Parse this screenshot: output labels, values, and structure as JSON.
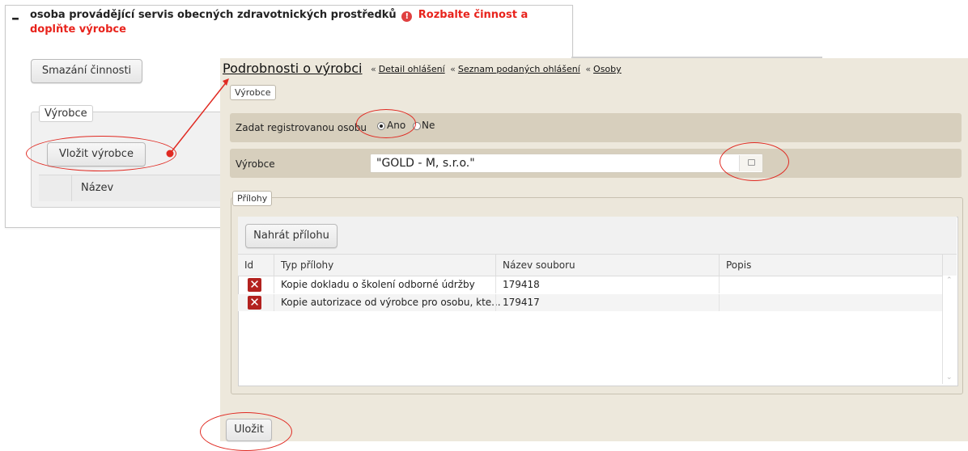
{
  "background_panel": {
    "collapse_symbol": "–",
    "activity_title": "osoba provádějící servis obecných zdravotnických prostředků",
    "warning_icon": "!",
    "warning_text": "Rozbalte činnost a doplňte výrobce",
    "delete_activity_button": "Smazání činnosti",
    "fieldset_legend": "Výrobce",
    "insert_manufacturer_button": "Vložit výrobce",
    "table_header_name": "Název"
  },
  "dialog": {
    "title": "Podrobnosti o výrobci",
    "breadcrumb": [
      {
        "sep": "«",
        "label": "Detail ohlášení"
      },
      {
        "sep": "«",
        "label": "Seznam podaných ohlášení"
      },
      {
        "sep": "«",
        "label": "Osoby"
      }
    ],
    "fieldset_legend": "Výrobce",
    "registered_person": {
      "label": "Zadat registrovanou osobu",
      "options": [
        "Ano",
        "Ne"
      ],
      "selected": "Ano"
    },
    "manufacturer": {
      "label": "Výrobce",
      "value": "\"GOLD - M, s.r.o.\"",
      "lookup_icon": "lookup-icon"
    },
    "attachments": {
      "legend": "Přílohy",
      "upload_button": "Nahrát přílohu",
      "columns": [
        "Id",
        "Typ přílohy",
        "Název souboru",
        "Popis"
      ],
      "rows": [
        {
          "type": "Kopie dokladu o školení odborné údržby",
          "file": "179418",
          "desc": ""
        },
        {
          "type": "Kopie autorizace od výrobce pro osobu, kte...",
          "file": "179417",
          "desc": ""
        }
      ],
      "delete_icon": "✕"
    },
    "save_button": "Uložit"
  },
  "colors": {
    "annotation_red": "#e02a22",
    "dialog_bg": "#ede8dc",
    "row_band": "#d7cfbd",
    "warning_red": "#e8231c"
  }
}
